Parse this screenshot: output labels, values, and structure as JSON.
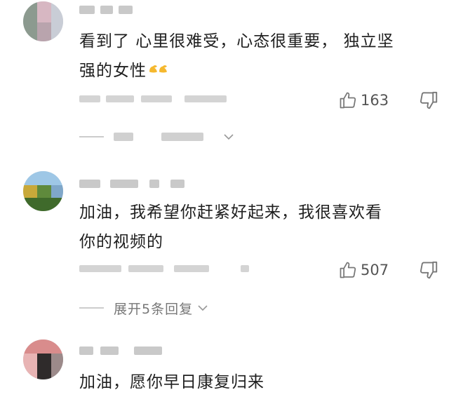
{
  "comments": [
    {
      "text_line1": "看到了 心里很难受，心态很重要， 独立坚",
      "text_line2": "强的女性",
      "emoji": "flexed-biceps-emoji",
      "likes": "163",
      "reply_label": ""
    },
    {
      "text_line1": "加油，我希望你赶紧好起来，我很喜欢看",
      "text_line2": "你的视频的",
      "likes": "507",
      "reply_label": "展开5条回复"
    },
    {
      "text_line1": "加油，愿你早日康复归来"
    }
  ],
  "colors": {
    "emoji": "#f5b82e",
    "icon": "#777777",
    "divider": "#cccccc"
  }
}
